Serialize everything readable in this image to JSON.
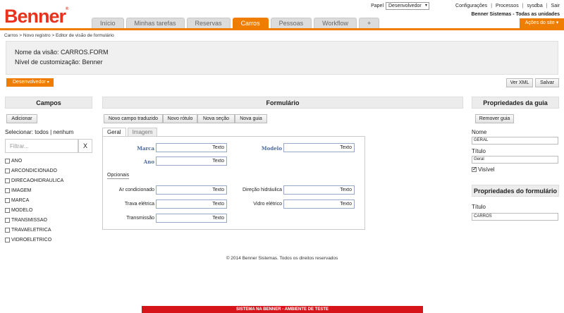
{
  "header": {
    "logo": "Benner",
    "logo_mark": "®",
    "papel_label": "Papel",
    "papel_value": "Desenvolvedor",
    "links": [
      "Configurações",
      "Processos",
      "sysdba",
      "Sair"
    ],
    "company": "Benner Sistemas - Todas as unidades",
    "acoes": "Ações do site",
    "tabs": [
      "Início",
      "Minhas tarefas",
      "Reservas",
      "Carros",
      "Pessoas",
      "Workflow",
      "+"
    ],
    "active_tab": "Carros"
  },
  "breadcrumb": "Carros > Novo registro > Editor de visão de formulário",
  "info": {
    "nome": "Nome da visão: CARROS.FORM",
    "nivel": "Nível de customização: Benner"
  },
  "dev_badge": "Desenvolvedor",
  "actions": {
    "ver_xml": "Ver XML",
    "salvar": "Salvar"
  },
  "campos": {
    "title": "Campos",
    "adicionar": "Adicionar",
    "selecionar_label": "Selecionar:",
    "todos": "todos",
    "sep": "|",
    "nenhum": "nenhum",
    "filter_placeholder": "Filtrar...",
    "clear": "X",
    "fields": [
      "ANO",
      "ARCONDICIONADO",
      "DIRECAOHIDRAULICA",
      "IMAGEM",
      "MARCA",
      "MODELO",
      "TRANSMISSAO",
      "TRAVAELETRICA",
      "VIDROELETRICO"
    ]
  },
  "formulario": {
    "title": "Formulário",
    "toolbar": [
      "Novo campo traduzido",
      "Novo rótulo",
      "Nova seção",
      "Nova guia"
    ],
    "tabs": [
      "Geral",
      "Imagem"
    ],
    "fields": {
      "marca": {
        "label": "Marca",
        "value": "Texto"
      },
      "modelo": {
        "label": "Modelo",
        "value": "Texto"
      },
      "ano": {
        "label": "Ano",
        "value": "Texto"
      },
      "section": "Opcionais",
      "ar": {
        "label": "Ar condicionado",
        "value": "Texto"
      },
      "direcao": {
        "label": "Direção hidráulica",
        "value": "Texto"
      },
      "trava": {
        "label": "Trava elétrica",
        "value": "Texto"
      },
      "vidro": {
        "label": "Vidro elétrico",
        "value": "Texto"
      },
      "transmissao": {
        "label": "Transmissão",
        "value": "Texto"
      }
    }
  },
  "prop_guia": {
    "title": "Propriedades da guia",
    "remover": "Remover guia",
    "nome_label": "Nome",
    "nome_value": "GERAL",
    "titulo_label": "Título",
    "titulo_value": "Geral",
    "visivel": "Visível"
  },
  "prop_form": {
    "title": "Propriedades do formulário",
    "titulo_label": "Título",
    "titulo_value": "CARROS"
  },
  "footer": "© 2014 Benner Sistemas. Todos os direitos reservados",
  "env_bar": "SISTEMA NA BENNER - AMBIENTE DE TESTE",
  "colors": {
    "accent": "#ee7d00",
    "brand": "#e8321e",
    "env": "#d8141b"
  }
}
